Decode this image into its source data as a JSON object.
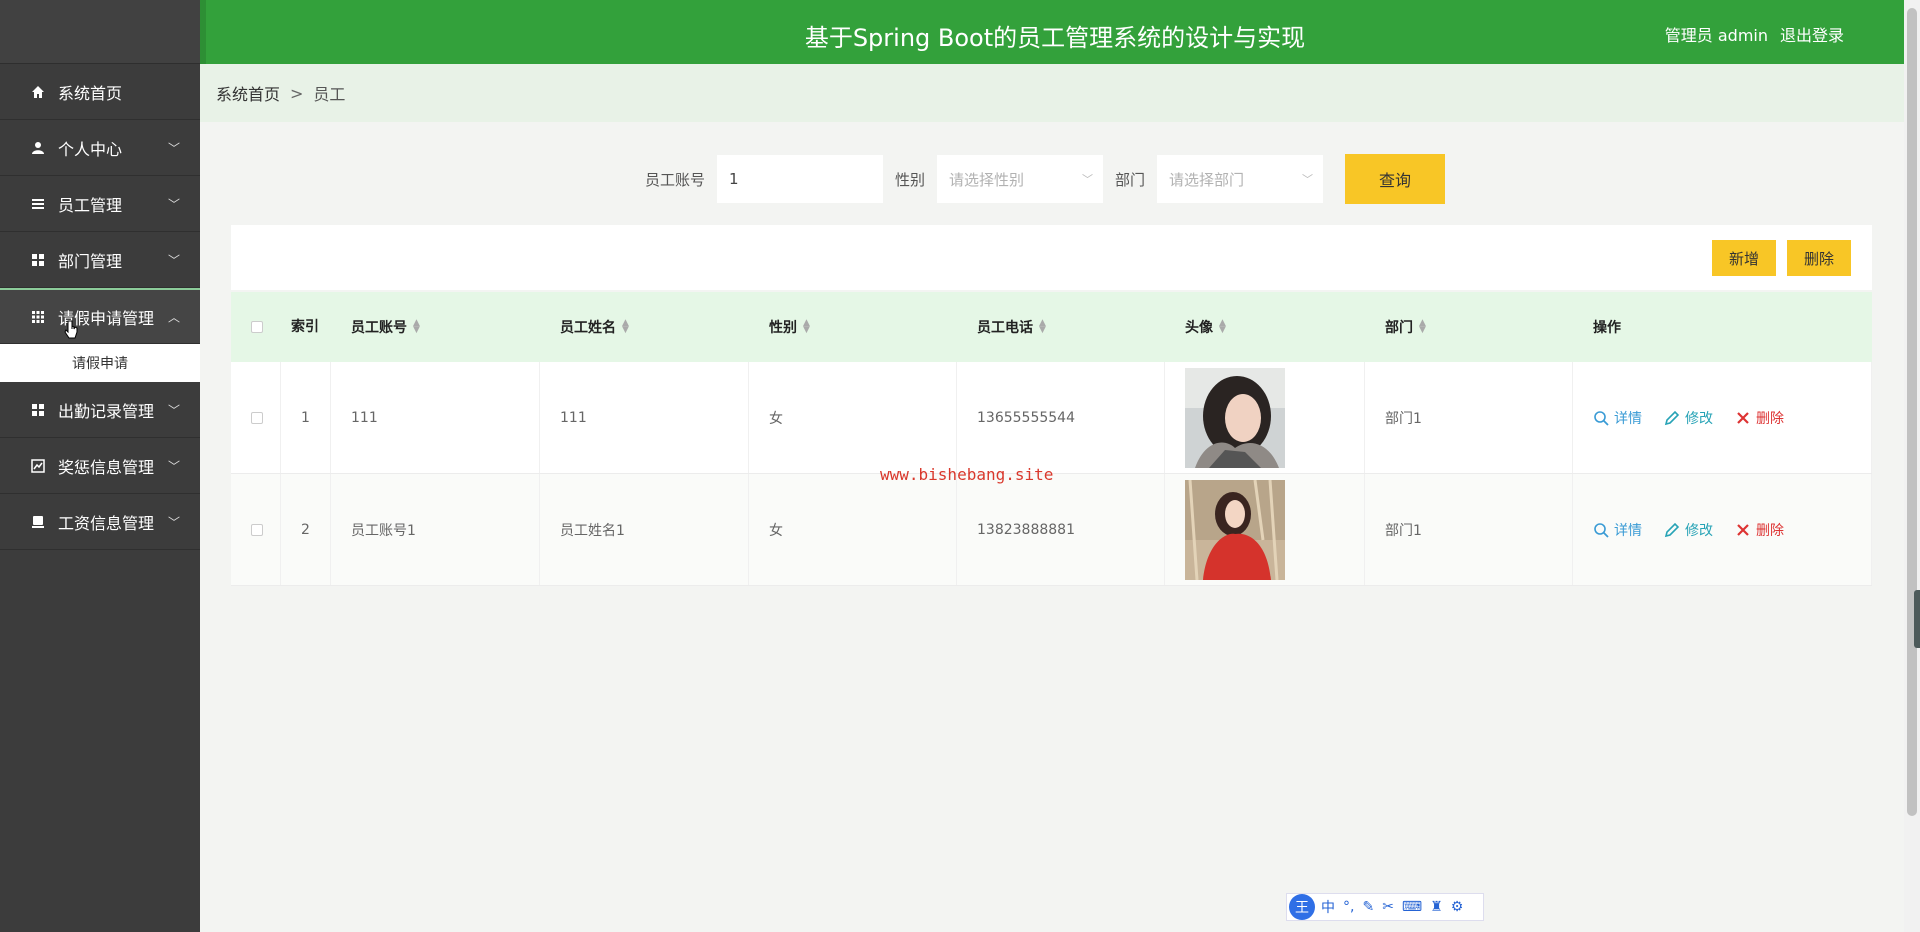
{
  "header": {
    "title": "基于Spring Boot的员工管理系统的设计与实现",
    "user": "管理员 admin",
    "logout": "退出登录"
  },
  "sidebar": {
    "items": [
      {
        "label": "系统首页",
        "icon": "home-icon"
      },
      {
        "label": "个人中心",
        "icon": "user-icon"
      },
      {
        "label": "员工管理",
        "icon": "list-icon"
      },
      {
        "label": "部门管理",
        "icon": "grid-icon"
      },
      {
        "label": "请假申请管理",
        "icon": "apps-icon"
      },
      {
        "label": "出勤记录管理",
        "icon": "grid-icon"
      },
      {
        "label": "奖惩信息管理",
        "icon": "chart-icon"
      },
      {
        "label": "工资信息管理",
        "icon": "card-icon"
      }
    ],
    "submenu": [
      "请假申请"
    ]
  },
  "breadcrumb": {
    "home": "系统首页",
    "separator": ">",
    "current": "员工"
  },
  "search": {
    "account_label": "员工账号",
    "account_value": "1",
    "gender_label": "性别",
    "gender_placeholder": "请选择性别",
    "dept_label": "部门",
    "dept_placeholder": "请选择部门",
    "query_button": "查询"
  },
  "actions": {
    "add": "新增",
    "delete": "删除"
  },
  "table": {
    "columns": [
      "索引",
      "员工账号",
      "员工姓名",
      "性别",
      "员工电话",
      "头像",
      "部门",
      "操作"
    ],
    "rows": [
      {
        "index": "1",
        "account": "111",
        "name": "111",
        "gender": "女",
        "phone": "13655555544",
        "dept": "部门1"
      },
      {
        "index": "2",
        "account": "员工账号1",
        "name": "员工姓名1",
        "gender": "女",
        "phone": "13823888881",
        "dept": "部门1"
      }
    ],
    "ops": {
      "detail": "详情",
      "edit": "修改",
      "delete": "删除"
    }
  },
  "watermark": "www.bishebang.site",
  "ime": {
    "logo": "王",
    "mode": "中"
  },
  "colors": {
    "header": "#33a13b",
    "sidebar": "#3c3c3c",
    "accent": "#f8c626",
    "table_header": "#e5f7e6"
  }
}
